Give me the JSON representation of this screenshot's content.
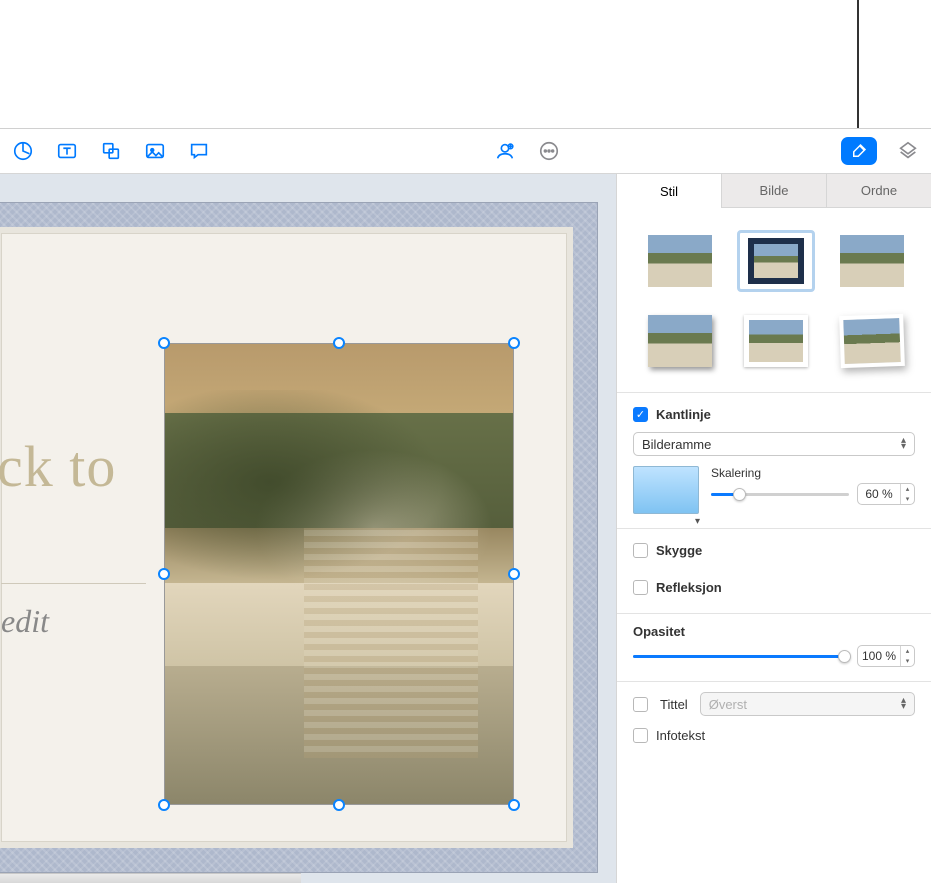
{
  "toolbar": {
    "icons": [
      "pie-chart-icon",
      "text-box-icon",
      "shape-icon",
      "image-icon",
      "comment-icon",
      "collab-icon",
      "more-icon",
      "format-icon",
      "animate-icon"
    ]
  },
  "canvas": {
    "title_text": "ck to",
    "subtitle_text": "edit"
  },
  "inspector": {
    "tabs": [
      "Stil",
      "Bilde",
      "Ordne"
    ],
    "active_tab": 0,
    "style_thumbs": [
      "plain",
      "framed",
      "plain",
      "shadow",
      "white-border",
      "curl"
    ],
    "selected_style": 1,
    "border": {
      "enabled": true,
      "label": "Kantlinje",
      "type_label": "Bilderamme",
      "scale_label": "Skalering",
      "scale_value": "60 %",
      "scale_pct": 20
    },
    "shadow": {
      "enabled": false,
      "label": "Skygge"
    },
    "reflection": {
      "enabled": false,
      "label": "Refleksjon"
    },
    "opacity": {
      "label": "Opasitet",
      "value": "100 %",
      "pct": 100
    },
    "title_cb": {
      "enabled": false,
      "label": "Tittel",
      "position": "Øverst"
    },
    "caption": {
      "enabled": false,
      "label": "Infotekst"
    }
  }
}
